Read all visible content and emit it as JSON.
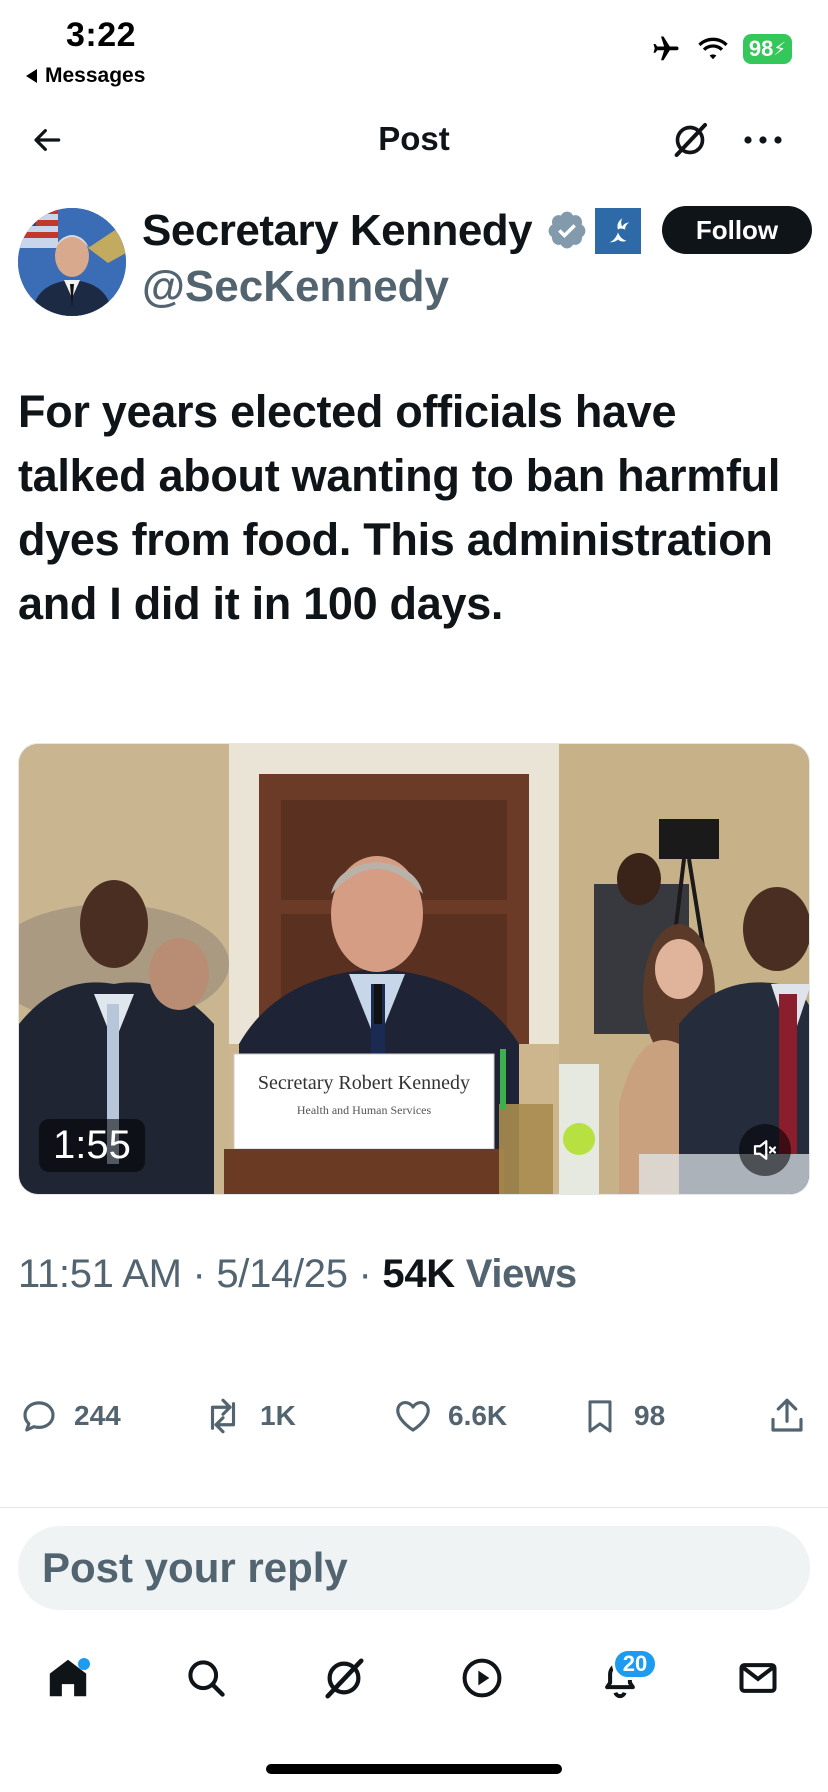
{
  "status_bar": {
    "time": "3:22",
    "back_app": "Messages",
    "battery": "98",
    "icons": [
      "airplane-icon",
      "wifi-icon",
      "battery-icon"
    ]
  },
  "header": {
    "title": "Post",
    "icons": [
      "back-arrow-icon",
      "grok-icon",
      "more-icon"
    ]
  },
  "author": {
    "name": "Secretary Kennedy",
    "handle": "@SecKennedy",
    "follow_label": "Follow",
    "badges": [
      "verified-gray-icon",
      "hhs-affiliate-icon"
    ]
  },
  "post": {
    "text": "For years elected officials have talked about wanting to ban harmful dyes from food. This administration and I did it in 100 days.",
    "video": {
      "duration": "1:55",
      "placard_line1": "Secretary Robert Kennedy",
      "placard_line2": "Health and Human Services",
      "muted": true
    },
    "time": "11:51 AM",
    "date": "5/14/25",
    "views_count": "54K",
    "views_label": "Views",
    "separator": "·"
  },
  "actions": {
    "replies": "244",
    "reposts": "1K",
    "likes": "6.6K",
    "bookmarks": "98"
  },
  "reply": {
    "placeholder": "Post your reply"
  },
  "tabbar": {
    "notifications_count": "20",
    "accent": "#1d9bf0",
    "items": [
      "home-icon",
      "search-icon",
      "grok-icon",
      "video-icon",
      "notifications-icon",
      "messages-icon"
    ]
  },
  "colors": {
    "text_primary": "#0f1419",
    "text_secondary": "#536471",
    "battery_green": "#34c759"
  }
}
